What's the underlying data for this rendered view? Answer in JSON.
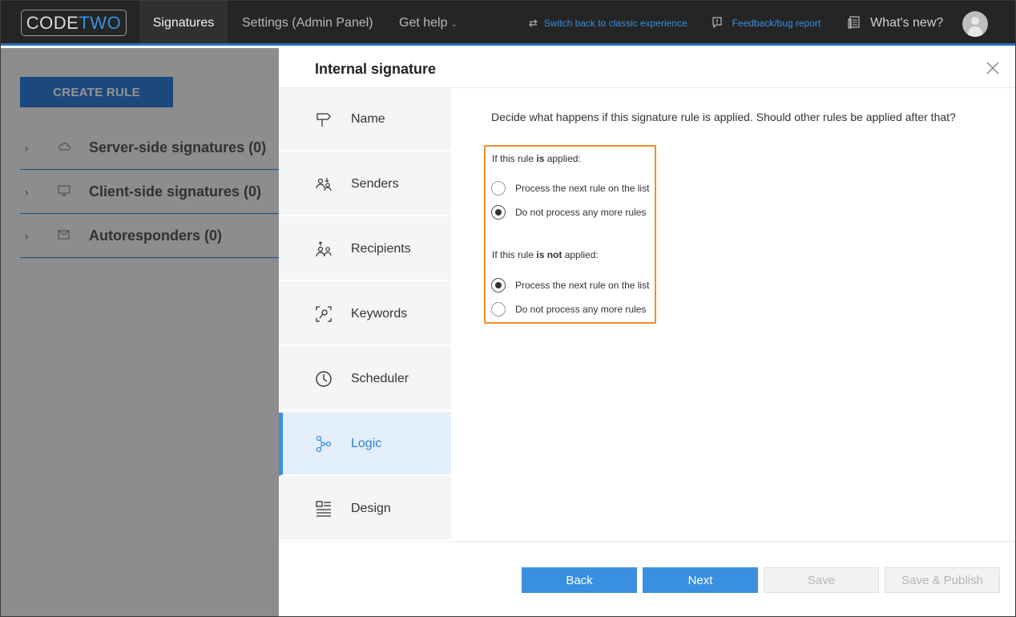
{
  "topbar": {
    "logo": {
      "part1": "CODE",
      "part2": "TWO"
    },
    "nav": [
      {
        "label": "Signatures",
        "active": true
      },
      {
        "label": "Settings (Admin Panel)",
        "active": false
      },
      {
        "label": "Get help",
        "active": false
      }
    ],
    "switch_link": "Switch back to classic experience",
    "feedback_link": "Feedback/bug report",
    "whats_new": "What's new?",
    "accent_color": "#2d6fc1"
  },
  "background": {
    "create_rule": "CREATE RULE",
    "tree": [
      {
        "label": "Server-side signatures (0)",
        "icon": "cloud-icon"
      },
      {
        "label": "Client-side signatures (0)",
        "icon": "monitor-icon"
      },
      {
        "label": "Autoresponders (0)",
        "icon": "envelope-icon"
      }
    ]
  },
  "modal": {
    "title": "Internal signature",
    "steps": [
      {
        "label": "Name",
        "icon": "signpost-icon",
        "active": false
      },
      {
        "label": "Senders",
        "icon": "senders-icon",
        "active": false
      },
      {
        "label": "Recipients",
        "icon": "recipients-icon",
        "active": false
      },
      {
        "label": "Keywords",
        "icon": "keywords-icon",
        "active": false
      },
      {
        "label": "Scheduler",
        "icon": "clock-icon",
        "active": true
      },
      {
        "label": "Logic",
        "icon": "logic-icon",
        "active": true
      },
      {
        "label": "Design",
        "icon": "design-icon",
        "active": false
      }
    ],
    "lead": "Decide what happens if this signature rule is applied. Should other rules be applied after that?",
    "applied_group": {
      "prefix": "If this rule ",
      "emph": "is",
      "suffix": " applied:",
      "options": [
        {
          "label": "Process the next rule on the list",
          "checked": false
        },
        {
          "label": "Do not process any more rules",
          "checked": true
        }
      ]
    },
    "not_applied_group": {
      "prefix": "If this rule ",
      "emph": "is not",
      "suffix": " applied:",
      "options": [
        {
          "label": "Process the next rule on the list",
          "checked": true
        },
        {
          "label": "Do not process any more rules",
          "checked": false
        }
      ]
    },
    "buttons": {
      "back": "Back",
      "next": "Next",
      "save": "Save",
      "save_publish": "Save & Publish"
    },
    "highlight_color": "#f28c28"
  }
}
